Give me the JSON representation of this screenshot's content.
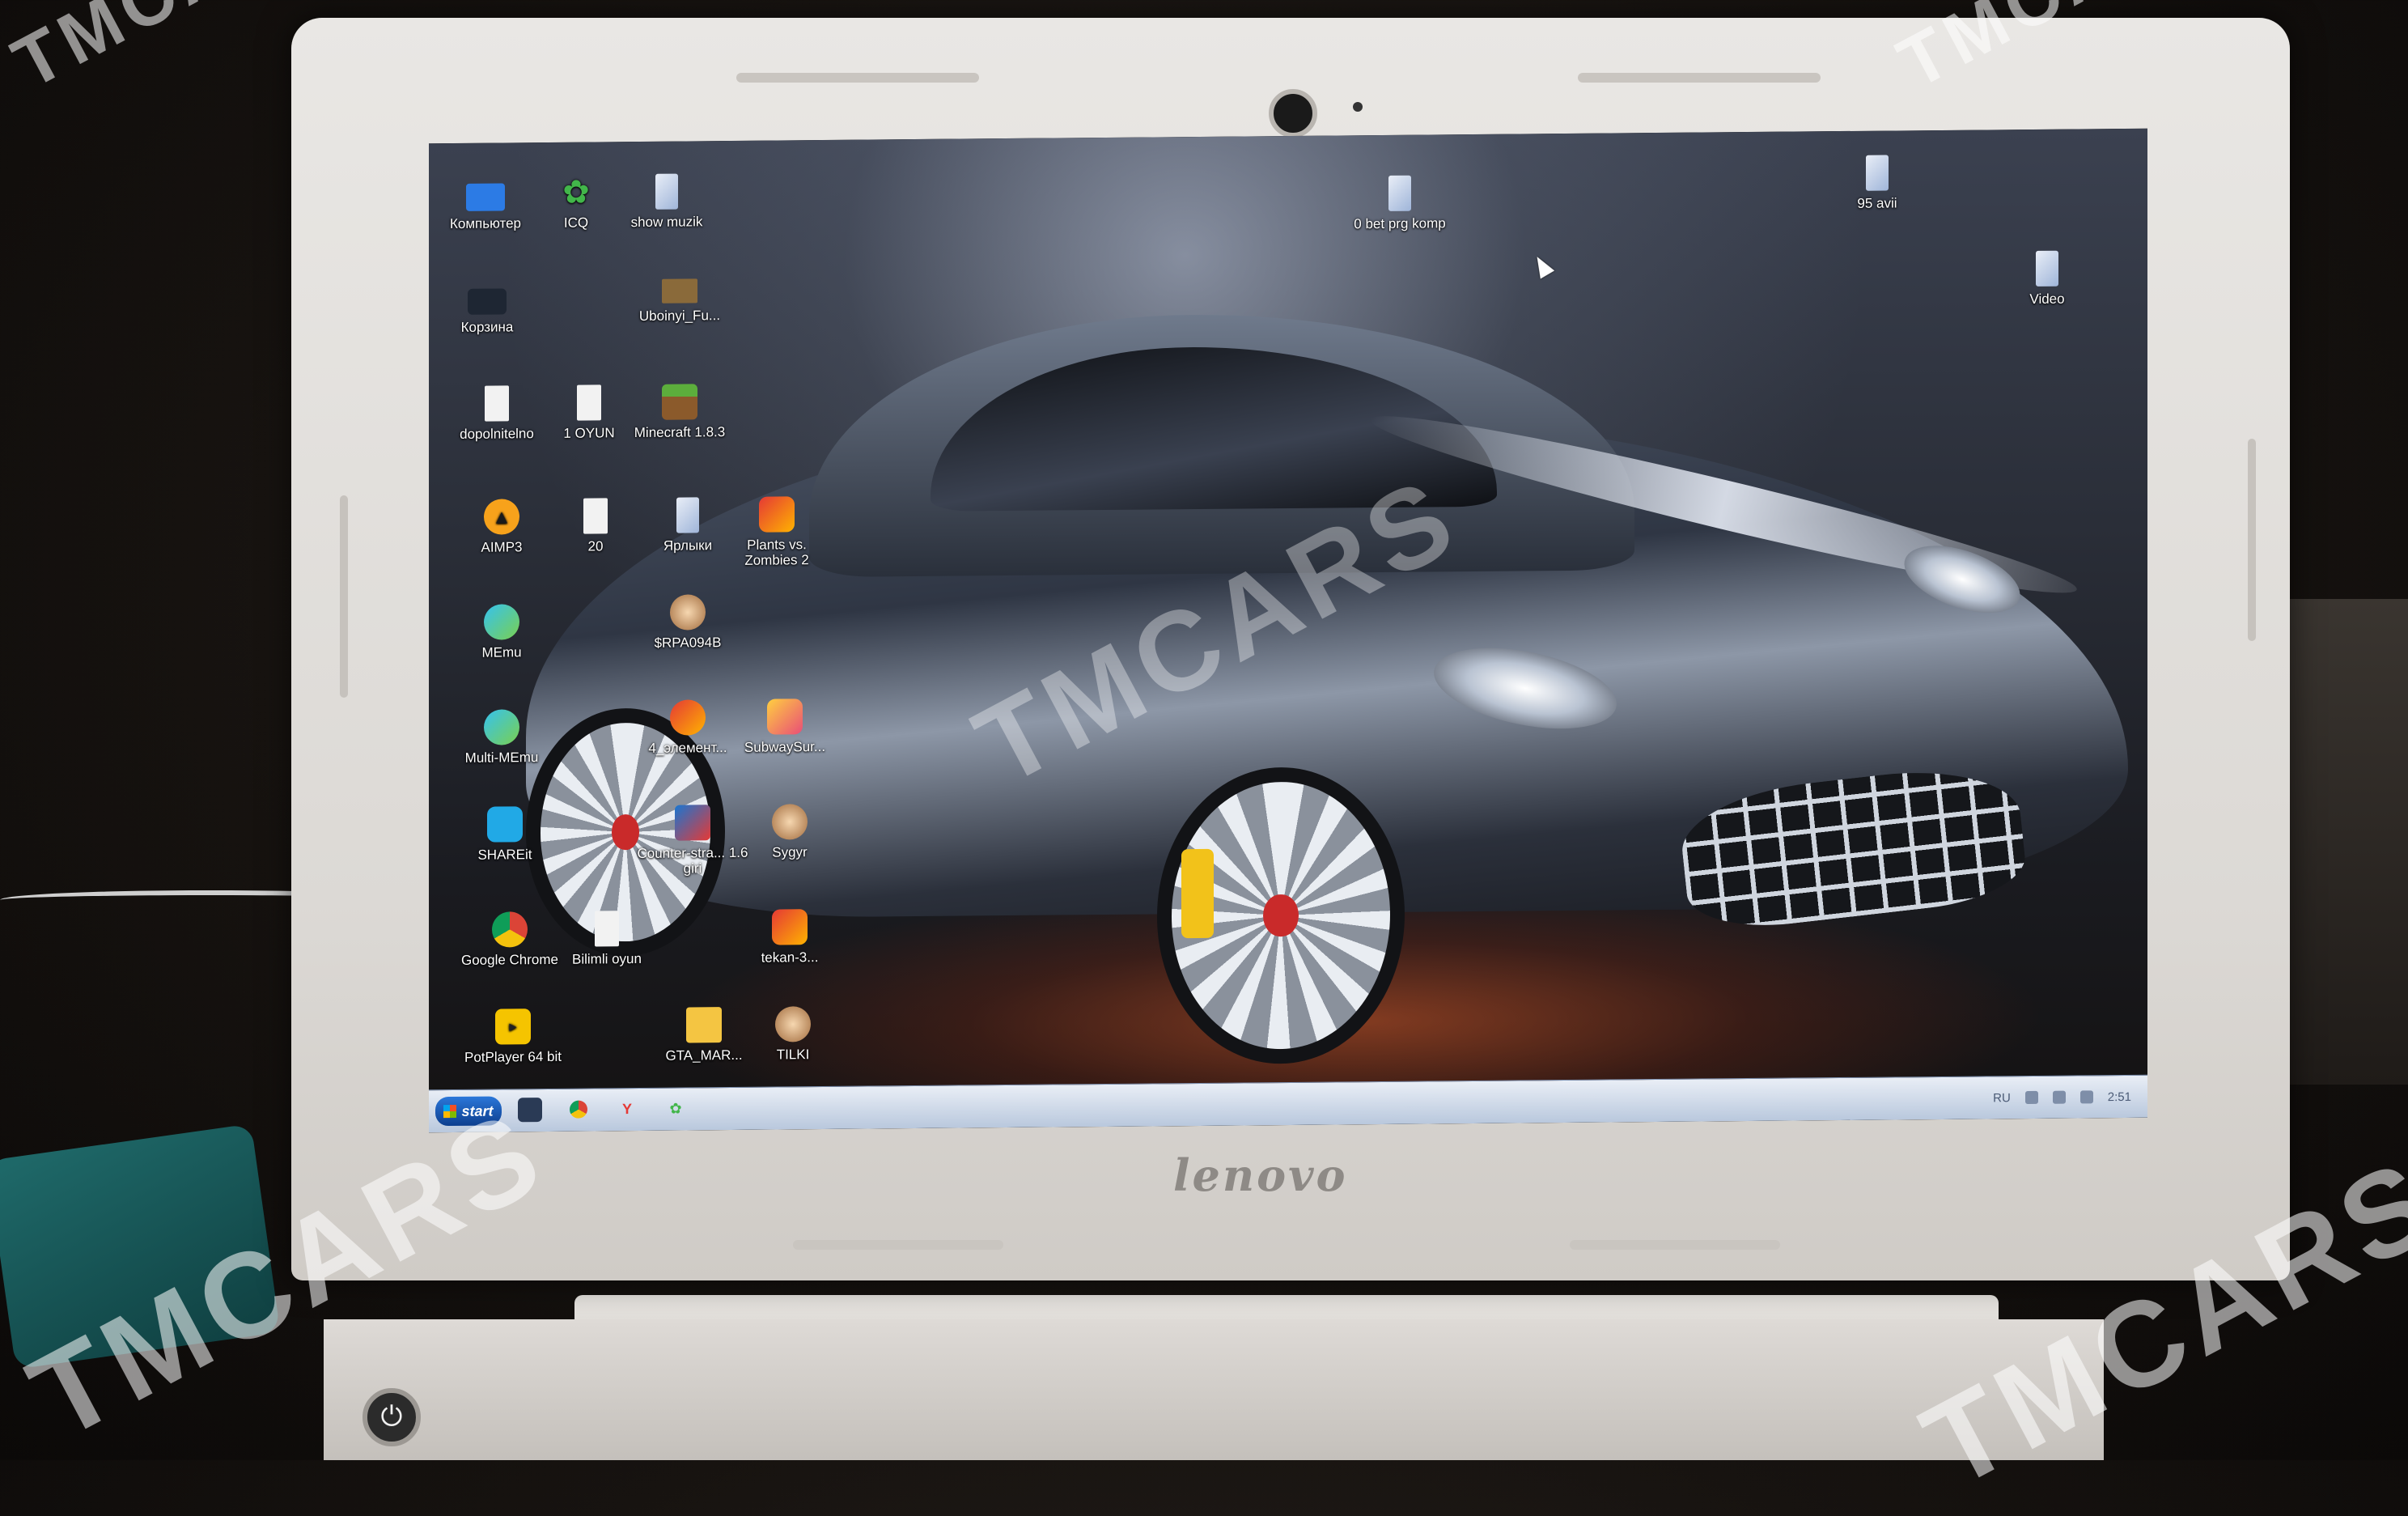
{
  "brand": "lenovo",
  "watermark": "TMCARS",
  "desktop_icons": [
    {
      "label": "Компьютер",
      "icon": "computer-icon"
    },
    {
      "label": "ICQ",
      "icon": "icq-flower-icon"
    },
    {
      "label": "show muzik",
      "icon": "shortcut-icon"
    },
    {
      "label": "Корзина",
      "icon": "recycle-bin-icon"
    },
    {
      "label": "Uboinyi_Fu...",
      "icon": "media-file-icon"
    },
    {
      "label": "dopolnitelno",
      "icon": "document-icon"
    },
    {
      "label": "1 OYUN",
      "icon": "document-icon"
    },
    {
      "label": "Minecraft 1.8.3",
      "icon": "minecraft-icon"
    },
    {
      "label": "AIMP3",
      "icon": "aimp-icon"
    },
    {
      "label": "20",
      "icon": "document-icon"
    },
    {
      "label": "Ярлыки",
      "icon": "shortcut-icon"
    },
    {
      "label": "Plants vs. Zombies 2",
      "icon": "game-icon"
    },
    {
      "label": "MEmu",
      "icon": "memu-icon"
    },
    {
      "label": "$RPA094B",
      "icon": "avatar-icon"
    },
    {
      "label": "Multi-MEmu",
      "icon": "memu-icon"
    },
    {
      "label": "4_элемент...",
      "icon": "game-icon"
    },
    {
      "label": "SubwaySur...",
      "icon": "subway-surfers-icon"
    },
    {
      "label": "SHAREit",
      "icon": "shareit-icon"
    },
    {
      "label": "Counter-stra... 1.6 giri",
      "icon": "counter-strike-icon"
    },
    {
      "label": "Sygyr",
      "icon": "avatar-icon"
    },
    {
      "label": "Google Chrome",
      "icon": "chrome-icon"
    },
    {
      "label": "Bilimli oyun",
      "icon": "document-icon"
    },
    {
      "label": "tekan-3...",
      "icon": "game-icon"
    },
    {
      "label": "PotPlayer 64 bit",
      "icon": "potplayer-icon"
    },
    {
      "label": "GTA_MAR...",
      "icon": "gta-icon"
    },
    {
      "label": "TILKI",
      "icon": "avatar-icon"
    },
    {
      "label": "0 bet prg komp",
      "icon": "shortcut-icon"
    },
    {
      "label": "95 avii",
      "icon": "shortcut-icon"
    },
    {
      "label": "Video",
      "icon": "shortcut-icon"
    }
  ],
  "taskbar": {
    "start_label": "start",
    "items": [
      "explorer-icon",
      "chrome-icon",
      "yandex-icon",
      "icq-flower-icon"
    ],
    "language": "RU",
    "clock": "2:51"
  }
}
